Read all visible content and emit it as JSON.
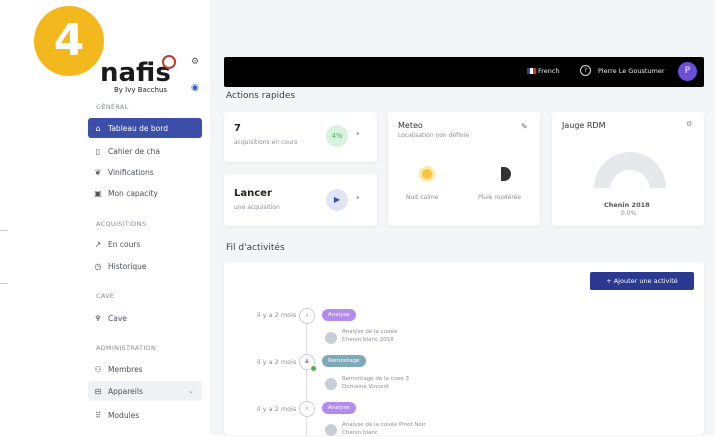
{
  "badge": "4",
  "logo": {
    "name": "nafis",
    "subtitle": "By Ivy Bacchus"
  },
  "sidebar": {
    "section_general": "GÉNÉRAL",
    "items_general": [
      {
        "label": "Tableau de bord",
        "icon": "home-icon"
      },
      {
        "label": "Cahier de cha",
        "icon": "notebook-icon"
      },
      {
        "label": "Vinifications",
        "icon": "grape-icon"
      },
      {
        "label": "Mon capacity",
        "icon": "box-icon"
      }
    ],
    "section_acquisitions": "ACQUISITIONS",
    "items_acquisitions": [
      {
        "label": "En cours",
        "icon": "trend-icon"
      },
      {
        "label": "Historique",
        "icon": "clock-icon"
      }
    ],
    "section_cave": "CAVE",
    "items_cave": [
      {
        "label": "Cave",
        "icon": "barrel-icon"
      }
    ],
    "section_admin": "ADMINISTRATION",
    "items_admin": [
      {
        "label": "Membres",
        "icon": "users-icon"
      },
      {
        "label": "Appareils",
        "icon": "device-icon"
      },
      {
        "label": "Modules",
        "icon": "grid-icon"
      }
    ]
  },
  "topbar": {
    "language": "French",
    "help": "?",
    "user_name": "Pierre Le Goustumer",
    "avatar_letter": "P"
  },
  "quick_actions": {
    "title": "Actions rapides",
    "acquisitions_count": "7",
    "acquisitions_label": "acquisitions en cours",
    "acquisitions_icon_text": "4%",
    "launch_title": "Lancer",
    "launch_label": "une acquisition"
  },
  "weather": {
    "title": "Meteo",
    "subtitle": "Localisation non définie",
    "day_label": "Nuit calme",
    "night_label": "Pluie modérée"
  },
  "gauge": {
    "title": "Jauge RDM",
    "value_label": "Chenin 2018",
    "percent": "0.0%",
    "level": 0.0
  },
  "activity": {
    "title": "Fil d'activités",
    "add_button": "+ Ajouter une activité",
    "entries": [
      {
        "time": "il y a 2 mois",
        "tag": "Analyse",
        "line1": "Analyse de la cuvée",
        "line2": "Chenin blanc 2018"
      },
      {
        "time": "il y a 2 mois",
        "tag": "Remontage",
        "line1": "Remontage de la cuve 3",
        "line2": "Domaine Vincent"
      },
      {
        "time": "il y a 2 mois",
        "tag": "Analyse",
        "line1": "Analyse de la cuvée Pinot Noir",
        "line2": "Chenin blanc"
      }
    ]
  },
  "colors": {
    "accent": "#3b4fa8",
    "badge": "#f3b81d",
    "topbar": "#000000"
  }
}
